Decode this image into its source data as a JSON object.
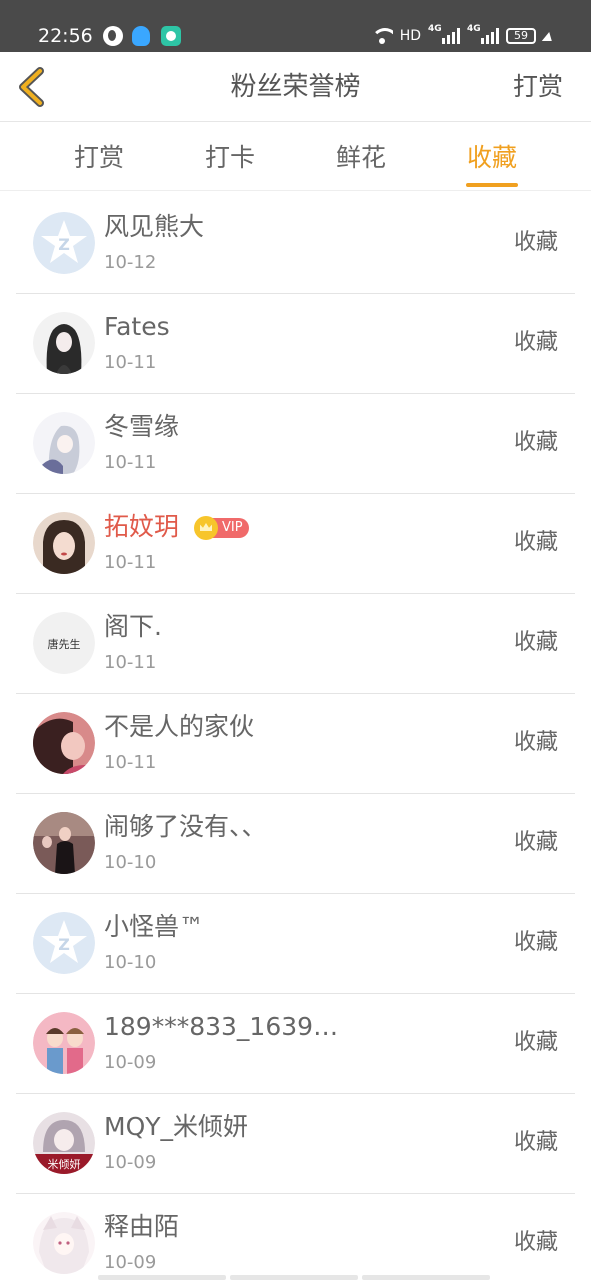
{
  "status_bar": {
    "time": "22:56",
    "network_label": "HD",
    "signal1_label": "4G",
    "signal2_label": "4G",
    "battery": "59"
  },
  "header": {
    "title": "粉丝荣誉榜",
    "action_label": "打赏"
  },
  "tabs": [
    {
      "label": "打赏",
      "active": false
    },
    {
      "label": "打卡",
      "active": false
    },
    {
      "label": "鲜花",
      "active": false
    },
    {
      "label": "收藏",
      "active": true
    }
  ],
  "fans": [
    {
      "name": "风见熊大",
      "date": "10-12",
      "action": "收藏"
    },
    {
      "name": "Fates",
      "date": "10-11",
      "action": "收藏"
    },
    {
      "name": "冬雪缘",
      "date": "10-11",
      "action": "收藏"
    },
    {
      "name": "拓妏玥",
      "date": "10-11",
      "action": "收藏",
      "vip": "VIP"
    },
    {
      "name": "阁下.",
      "date": "10-11",
      "action": "收藏"
    },
    {
      "name": "不是人的家伙",
      "date": "10-11",
      "action": "收藏"
    },
    {
      "name": "闹够了没有、、",
      "date": "10-10",
      "action": "收藏"
    },
    {
      "name": "小怪兽™",
      "date": "10-10",
      "action": "收藏"
    },
    {
      "name": "189***833_16398...",
      "date": "10-09",
      "action": "收藏"
    },
    {
      "name": "MQY_米倾妍",
      "date": "10-09",
      "action": "收藏"
    },
    {
      "name": "释由陌",
      "date": "10-09",
      "action": "收藏"
    }
  ],
  "avatar_texts": {
    "fan5": "唐先生",
    "fan10": "米倾妍"
  },
  "colors": {
    "accent": "#f0a020",
    "vip_name": "#e05a4a",
    "status_bar": "#4a4a4a"
  }
}
